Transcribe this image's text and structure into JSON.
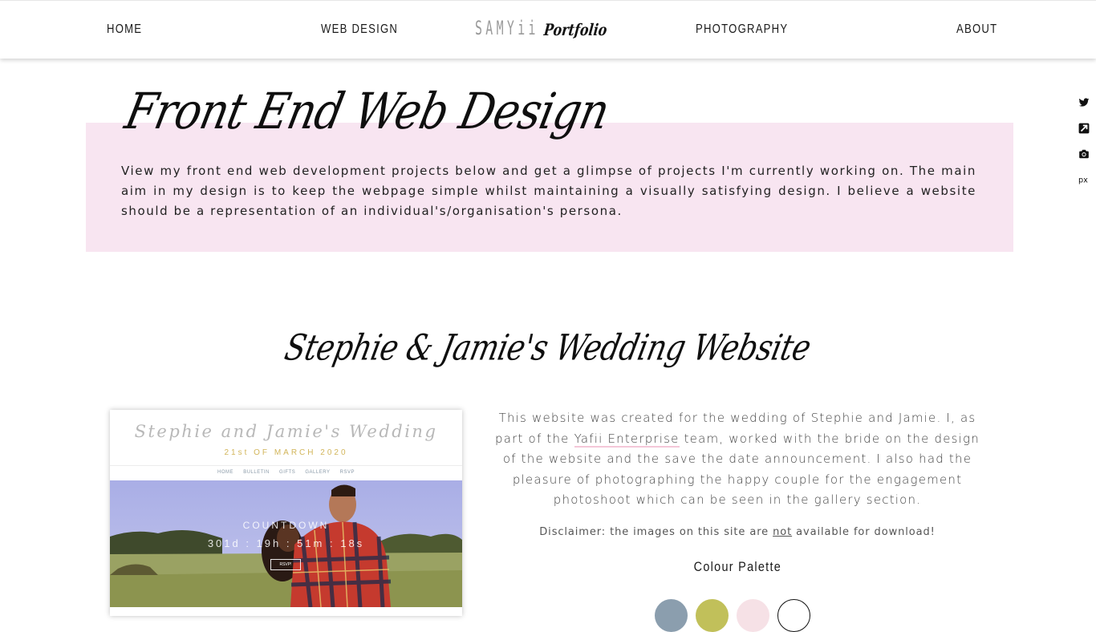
{
  "nav": {
    "home": "HOME",
    "web_design": "WEB DESIGN",
    "logo_brand": "SAMYii",
    "logo_sub": "Portfolio",
    "photography": "PHOTOGRAPHY",
    "about": "ABOUT"
  },
  "social": [
    "twitter-icon",
    "pinterest-icon",
    "camera-icon",
    "500px-icon"
  ],
  "intro": {
    "title": "Front End Web Design",
    "text": "View my front end web development projects below and get a glimpse of projects I'm currently working on. The main aim in my design is to keep the webpage simple whilst maintaining a visually satisfying design. I believe a website should be a representation of an individual's/organisation's persona."
  },
  "project": {
    "title": "Stephie & Jamie's Wedding Website",
    "preview": {
      "site_title": "Stephie and Jamie's Wedding",
      "date": "21st OF MARCH 2020",
      "menu": [
        "HOME",
        "BULLETIN",
        "GIFTS",
        "GALLERY",
        "RSVP"
      ],
      "countdown_label": "COUNTDOWN",
      "countdown_value": "301d : 19h : 51m : 18s",
      "rsvp_button": "RSVP!"
    },
    "description_before": "This website was created for the wedding of Stephie and Jamie. I, as part of the ",
    "description_link": "Yafii Enterprise",
    "description_after": " team, worked with the bride on the design of the website and the save the date announcement. I also had the pleasure of photographing the happy couple for the engagement photoshoot which can be seen in the gallery section.",
    "disclaimer_before": "Disclaimer: the images on this site are ",
    "disclaimer_em": "not",
    "disclaimer_after": " available for download!",
    "palette_title": "Colour Palette",
    "palette": [
      "#8b9eae",
      "#c1c05a",
      "#f6e1e6",
      "#ffffff"
    ]
  }
}
